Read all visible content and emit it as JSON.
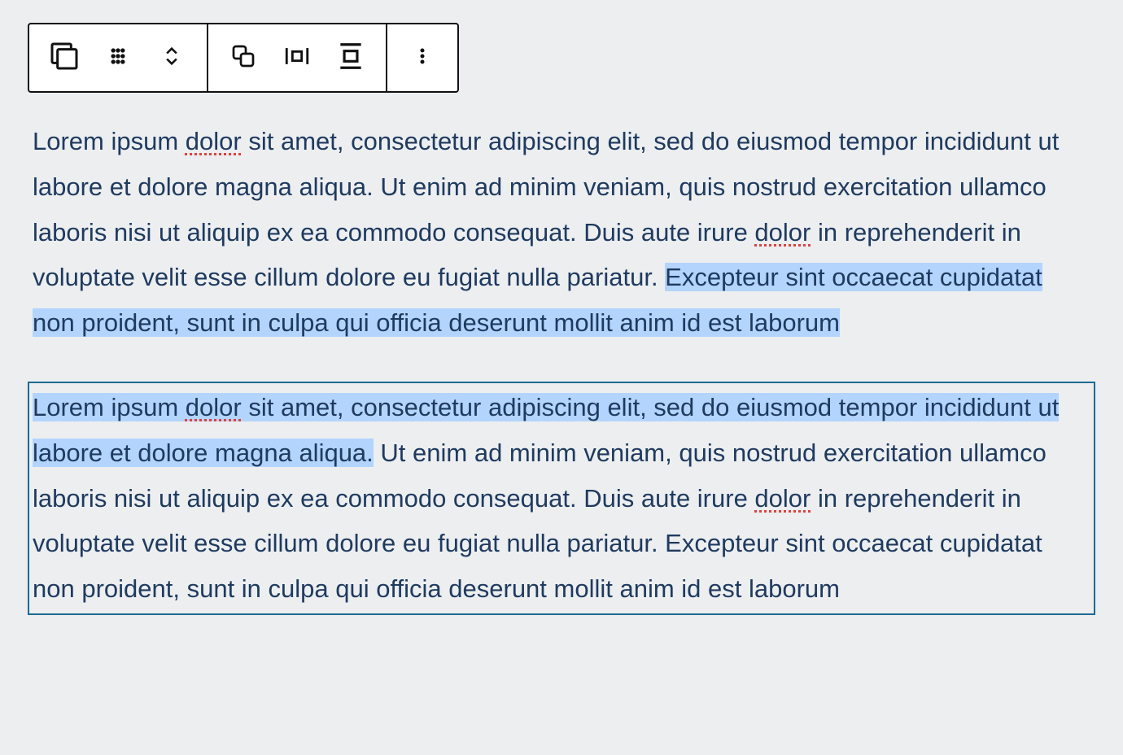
{
  "toolbar": {
    "group1": {
      "block_type_button": "Paragraph block",
      "drag_button": "Drag handle",
      "move_button": "Move up/down"
    },
    "group2": {
      "transform_button": "Change block type",
      "widen_button": "Wide width",
      "full_button": "Full width"
    },
    "group3": {
      "options_button": "More options"
    }
  },
  "paragraph1": {
    "t1": "Lorem ipsum ",
    "sp1": "dolor",
    "t2": " sit amet, consectetur adipiscing elit, sed do eiusmod tempor incididunt ut labore et dolore magna aliqua. Ut enim ad minim veniam, quis nostrud exercitation ullamco laboris nisi ut aliquip ex ea commodo consequat. Duis aute irure ",
    "sp2": "dolor",
    "t3": " in reprehenderit in voluptate velit esse cillum dolore eu fugiat nulla pariatur. ",
    "sel": "Excepteur sint occaecat cupidatat non proident, sunt in culpa qui officia deserunt mollit anim id est laborum"
  },
  "paragraph2": {
    "sel_a": "Lorem ipsum ",
    "sel_sp": "dolor",
    "sel_b": " sit amet, consectetur adipiscing elit, sed do eiusmod tempor incididunt ut labore et dolore magna aliqua.",
    "t1": " Ut enim ad minim veniam, quis nostrud exercitation ullamco laboris nisi ut aliquip ex ea commodo consequat. Duis aute irure ",
    "sp2": "dolor",
    "t2": " in reprehenderit in voluptate velit esse cillum dolore eu fugiat nulla pariatur. Excepteur sint occaecat cupidatat non proident, sunt in culpa qui officia deserunt mollit anim id est laborum"
  }
}
